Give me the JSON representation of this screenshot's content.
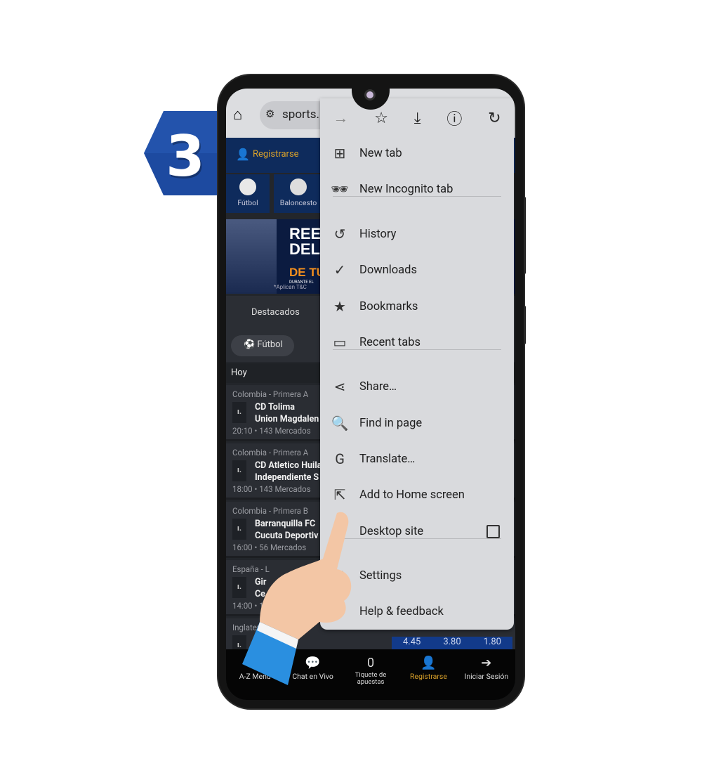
{
  "step_badge": "3",
  "browser": {
    "url": "sports."
  },
  "site": {
    "register": "Registrarse",
    "sports": [
      "Fútbol",
      "Baloncesto"
    ],
    "banner": {
      "line1": "REE",
      "line2": "DEL",
      "line3": "DE TU",
      "line4": "DURANTE EL",
      "note": "*Aplican T&C"
    },
    "tab": "Destacados",
    "chip": "Fútbol",
    "section": "Hoy",
    "matches": [
      {
        "league": "Colombia - Primera A",
        "team1": "CD Tolima",
        "team2": "Union Magdalen",
        "time": "20:10 • 143 Mercados"
      },
      {
        "league": "Colombia - Primera A",
        "team1": "CD Atletico Huila",
        "team2": "Independiente S",
        "time": "18:00 • 143 Mercados"
      },
      {
        "league": "Colombia - Primera B",
        "team1": "Barranquilla FC",
        "team2": "Cucuta Deportiv",
        "time": "16:00 • 56 Mercados"
      },
      {
        "league": "España - L",
        "team1": "Gir",
        "team2": "Ce",
        "time": "14:00 • 1"
      },
      {
        "league": "Inglater",
        "team1": "",
        "team2": "",
        "time": ""
      }
    ],
    "odds": [
      "4.45",
      "3.80",
      "1.80"
    ],
    "nav": [
      {
        "label": "A-Z Menu",
        "icon": "menu-icon"
      },
      {
        "label": "Chat en Vivo",
        "icon": "chat-icon"
      },
      {
        "label": "Tiquete de apuestas",
        "count": "0"
      },
      {
        "label": "Registrarse",
        "icon": "user-plus-icon"
      },
      {
        "label": "Iniciar Sesión",
        "icon": "login-icon"
      }
    ]
  },
  "menu": {
    "items": [
      {
        "label": "New tab",
        "icon": "new-tab-icon"
      },
      {
        "label": "New Incognito tab",
        "icon": "incognito-icon"
      },
      {
        "label": "History",
        "icon": "history-icon"
      },
      {
        "label": "Downloads",
        "icon": "downloads-icon"
      },
      {
        "label": "Bookmarks",
        "icon": "star-icon"
      },
      {
        "label": "Recent tabs",
        "icon": "devices-icon"
      },
      {
        "label": "Share…",
        "icon": "share-icon"
      },
      {
        "label": "Find in page",
        "icon": "find-icon"
      },
      {
        "label": "Translate…",
        "icon": "translate-icon"
      },
      {
        "label": "Add to Home screen",
        "icon": "add-home-icon"
      },
      {
        "label": "Desktop site",
        "icon": "desktop-icon",
        "checked": false
      },
      {
        "label": "Settings",
        "icon": "gear-icon"
      },
      {
        "label": "Help & feedback",
        "icon": "help-icon"
      }
    ]
  },
  "colors": {
    "badge": "#1d4aa0",
    "menu_bg": "#d9dadd",
    "site_blue": "#0e2b5c",
    "accent": "#d9a12a"
  }
}
